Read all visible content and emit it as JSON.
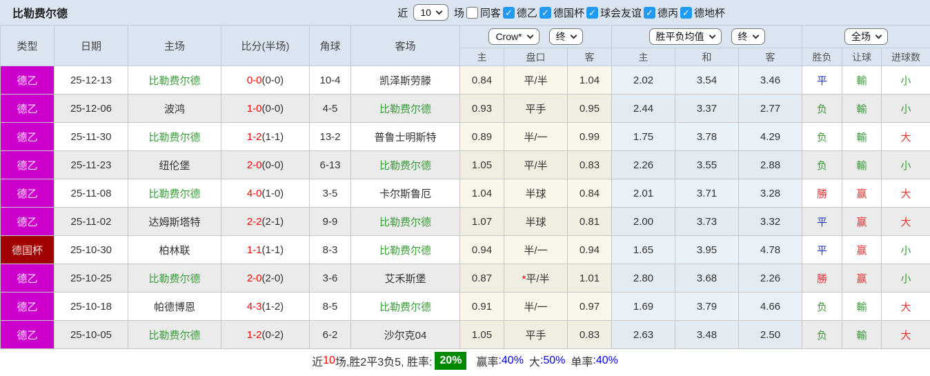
{
  "header": {
    "title": "比勒费尔德",
    "filters": {
      "recent_label": "近",
      "recent_value": "10",
      "games_label": "场",
      "same_away_label": "同客",
      "same_away_checked": false,
      "leagues": [
        {
          "label": "德乙",
          "checked": true
        },
        {
          "label": "德国杯",
          "checked": true
        },
        {
          "label": "球会友谊",
          "checked": true
        },
        {
          "label": "德丙",
          "checked": true
        },
        {
          "label": "德地杯",
          "checked": true
        }
      ]
    }
  },
  "table": {
    "columns": [
      "类型",
      "日期",
      "主场",
      "比分(半场)",
      "角球",
      "客场"
    ],
    "odds_group": {
      "select1": "Crow*",
      "select2": "终",
      "cols": [
        "主",
        "盘口",
        "客"
      ]
    },
    "avg_group": {
      "select1": "胜平负均值",
      "select2": "终",
      "cols": [
        "主",
        "和",
        "客"
      ]
    },
    "result_group": {
      "select": "全场",
      "cols": [
        "胜负",
        "让球",
        "进球数"
      ]
    },
    "rows": [
      {
        "type": "德乙",
        "cup": false,
        "date": "25-12-13",
        "home": "比勒费尔德",
        "home_green": true,
        "ft": "0-0",
        "ht": "(0-0)",
        "corners": "10-4",
        "away": "凯泽斯劳滕",
        "away_green": false,
        "odds": [
          "0.84",
          "平/半",
          "1.04"
        ],
        "star": false,
        "avg": [
          "2.02",
          "3.54",
          "3.46"
        ],
        "results": [
          [
            "平",
            "blue"
          ],
          [
            "輸",
            "green"
          ],
          [
            "小",
            "green"
          ]
        ]
      },
      {
        "type": "德乙",
        "cup": false,
        "date": "25-12-06",
        "home": "波鸿",
        "home_green": false,
        "ft": "1-0",
        "ht": "(0-0)",
        "corners": "4-5",
        "away": "比勒费尔德",
        "away_green": true,
        "odds": [
          "0.93",
          "平手",
          "0.95"
        ],
        "star": false,
        "avg": [
          "2.44",
          "3.37",
          "2.77"
        ],
        "results": [
          [
            "负",
            "green"
          ],
          [
            "輸",
            "green"
          ],
          [
            "小",
            "green"
          ]
        ]
      },
      {
        "type": "德乙",
        "cup": false,
        "date": "25-11-30",
        "home": "比勒费尔德",
        "home_green": true,
        "ft": "1-2",
        "ht": "(1-1)",
        "corners": "13-2",
        "away": "普鲁士明斯特",
        "away_green": false,
        "odds": [
          "0.89",
          "半/一",
          "0.99"
        ],
        "star": false,
        "avg": [
          "1.75",
          "3.78",
          "4.29"
        ],
        "results": [
          [
            "负",
            "green"
          ],
          [
            "輸",
            "green"
          ],
          [
            "大",
            "red"
          ]
        ]
      },
      {
        "type": "德乙",
        "cup": false,
        "date": "25-11-23",
        "home": "纽伦堡",
        "home_green": false,
        "ft": "2-0",
        "ht": "(0-0)",
        "corners": "6-13",
        "away": "比勒费尔德",
        "away_green": true,
        "odds": [
          "1.05",
          "平/半",
          "0.83"
        ],
        "star": false,
        "avg": [
          "2.26",
          "3.55",
          "2.88"
        ],
        "results": [
          [
            "负",
            "green"
          ],
          [
            "輸",
            "green"
          ],
          [
            "小",
            "green"
          ]
        ]
      },
      {
        "type": "德乙",
        "cup": false,
        "date": "25-11-08",
        "home": "比勒费尔德",
        "home_green": true,
        "ft": "4-0",
        "ht": "(1-0)",
        "corners": "3-5",
        "away": "卡尔斯鲁厄",
        "away_green": false,
        "odds": [
          "1.04",
          "半球",
          "0.84"
        ],
        "star": false,
        "avg": [
          "2.01",
          "3.71",
          "3.28"
        ],
        "results": [
          [
            "勝",
            "red"
          ],
          [
            "赢",
            "red"
          ],
          [
            "大",
            "red"
          ]
        ]
      },
      {
        "type": "德乙",
        "cup": false,
        "date": "25-11-02",
        "home": "达姆斯塔特",
        "home_green": false,
        "ft": "2-2",
        "ht": "(2-1)",
        "corners": "9-9",
        "away": "比勒费尔德",
        "away_green": true,
        "odds": [
          "1.07",
          "半球",
          "0.81"
        ],
        "star": false,
        "avg": [
          "2.00",
          "3.73",
          "3.32"
        ],
        "results": [
          [
            "平",
            "blue"
          ],
          [
            "赢",
            "red"
          ],
          [
            "大",
            "red"
          ]
        ]
      },
      {
        "type": "德国杯",
        "cup": true,
        "date": "25-10-30",
        "home": "柏林联",
        "home_green": false,
        "ft": "1-1",
        "ht": "(1-1)",
        "corners": "8-3",
        "away": "比勒费尔德",
        "away_green": true,
        "odds": [
          "0.94",
          "半/一",
          "0.94"
        ],
        "star": false,
        "avg": [
          "1.65",
          "3.95",
          "4.78"
        ],
        "results": [
          [
            "平",
            "blue"
          ],
          [
            "赢",
            "red"
          ],
          [
            "小",
            "green"
          ]
        ]
      },
      {
        "type": "德乙",
        "cup": false,
        "date": "25-10-25",
        "home": "比勒费尔德",
        "home_green": true,
        "ft": "2-0",
        "ht": "(2-0)",
        "corners": "3-6",
        "away": "艾禾斯堡",
        "away_green": false,
        "odds": [
          "0.87",
          "平/半",
          "1.01"
        ],
        "star": true,
        "avg": [
          "2.80",
          "3.68",
          "2.26"
        ],
        "results": [
          [
            "勝",
            "red"
          ],
          [
            "赢",
            "red"
          ],
          [
            "小",
            "green"
          ]
        ]
      },
      {
        "type": "德乙",
        "cup": false,
        "date": "25-10-18",
        "home": "帕德博恩",
        "home_green": false,
        "ft": "4-3",
        "ht": "(1-2)",
        "corners": "8-5",
        "away": "比勒费尔德",
        "away_green": true,
        "odds": [
          "0.91",
          "半/一",
          "0.97"
        ],
        "star": false,
        "avg": [
          "1.69",
          "3.79",
          "4.66"
        ],
        "results": [
          [
            "负",
            "green"
          ],
          [
            "輸",
            "green"
          ],
          [
            "大",
            "red"
          ]
        ]
      },
      {
        "type": "德乙",
        "cup": false,
        "date": "25-10-05",
        "home": "比勒费尔德",
        "home_green": true,
        "ft": "1-2",
        "ht": "(0-2)",
        "corners": "6-2",
        "away": "沙尔克04",
        "away_green": false,
        "odds": [
          "1.05",
          "平手",
          "0.83"
        ],
        "star": false,
        "avg": [
          "2.63",
          "3.48",
          "2.50"
        ],
        "results": [
          [
            "负",
            "green"
          ],
          [
            "輸",
            "green"
          ],
          [
            "大",
            "red"
          ]
        ]
      }
    ]
  },
  "footer": {
    "prefix": "近",
    "count": "10",
    "middle": "场,胜2平3负5, 胜率:",
    "win_rate": "20%",
    "segments": [
      {
        "label": "赢率",
        "value": ":40%"
      },
      {
        "label": "大",
        "value": ":50%"
      },
      {
        "label": "单率",
        "value": ":40%"
      }
    ]
  },
  "colors": {
    "header_bg": "#dbe5f1",
    "league_magenta": "#cc00cc",
    "cup_dark_red": "#a00000",
    "team_green": "#3a9d3a",
    "score_red": "#ff0000",
    "draw_blue": "#2233cc",
    "win_red": "#e63333",
    "lose_green": "#3a9d3a",
    "row_alt_gray": "#ebebeb",
    "odds_col_bg": "#faf6ea",
    "avg_col_bg": "#e9f1f9",
    "rate_badge_green": "#008a00",
    "value_blue": "#0000ee",
    "checkbox_blue": "#219af2"
  }
}
